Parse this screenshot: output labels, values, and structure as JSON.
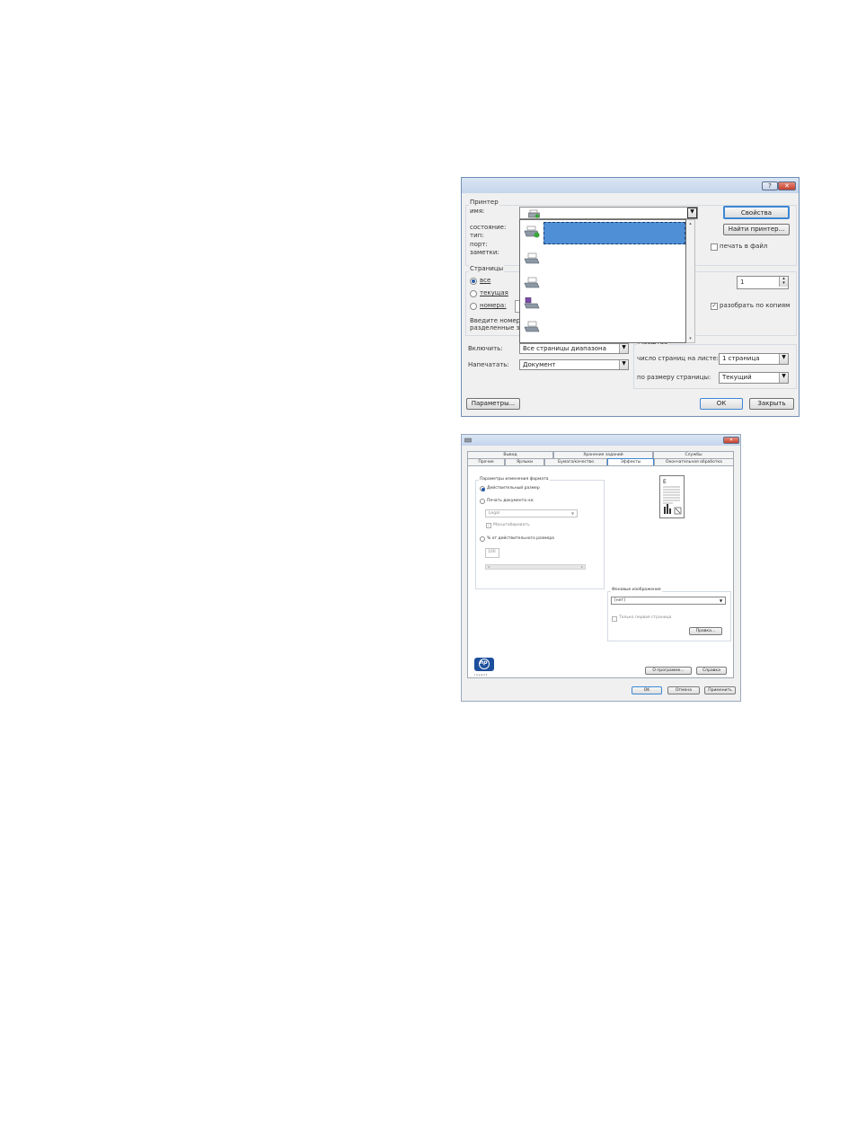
{
  "print_dialog": {
    "help_button": "?",
    "close_button": "✕",
    "printer_group": "Принтер",
    "name_label": "имя:",
    "status_label": "состояние:",
    "type_label": "тип:",
    "port_label": "порт:",
    "comment_label": "заметки:",
    "properties_button": "Свойства",
    "find_printer_button": "Найти принтер...",
    "print_to_file_label": "печать в файл",
    "pages_group": "Страницы",
    "all_label": "все",
    "current_label": "текущая",
    "numbers_label": "номера:",
    "hint_text_1": "Введите номер",
    "hint_text_2": "разделенные з",
    "copies_value": "1",
    "collate_label": "разобрать по копиям",
    "include_label": "Включить:",
    "include_value": "Все страницы диапазона",
    "print_what_label": "Напечатать:",
    "print_what_value": "Документ",
    "scale_group": "Масштаб",
    "pages_per_sheet_label": "число страниц на листе:",
    "pages_per_sheet_value": "1 страница",
    "scale_to_paper_label": "по размеру страницы:",
    "scale_to_paper_value": "Текущий",
    "options_button": "Параметры...",
    "ok_button": "ОК",
    "close_dialog_button": "Закрыть"
  },
  "properties_dialog": {
    "close_button": "✕",
    "tabs_row1": [
      "Вывод",
      "Хранение заданий",
      "Службы"
    ],
    "tabs_row2": [
      "Прочие",
      "Ярлыки",
      "Бумага/качество",
      "Эффекты",
      "Окончательная обработка"
    ],
    "resize_group": "Параметры изменения формата",
    "actual_size_label": "Действительный размер",
    "print_on_label": "Печать документа на:",
    "paper_value": "Legal",
    "scale_to_fit_label": "Масштабировать",
    "percent_label": "% от действительного размера",
    "percent_value": "100",
    "watermark_group": "Фоновые изображения",
    "watermark_value": "[нет]",
    "first_page_only_label": "Только первая страница",
    "edit_button": "Правка...",
    "hp_logo_text": "hp",
    "hp_invent_text": "i n v e n t",
    "about_button": "О программе...",
    "help_button": "Справка",
    "ok_button": "OK",
    "cancel_button": "Отмена",
    "apply_button": "Применить"
  },
  "colors": {
    "selection": "#4f8fd6",
    "window_border": "#6f8fb5",
    "close_red": "#c6412d"
  }
}
